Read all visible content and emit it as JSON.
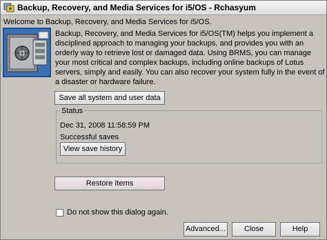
{
  "window": {
    "title": "Backup, Recovery, and Media Services for i5/OS - Rchasyum",
    "welcome": "Welcome to Backup, Recovery, and Media Services for i5/OS."
  },
  "intro": {
    "text": "Backup, Recovery, and Media Services for i5/OS(TM) helps you implement a disciplined approach to managing your backups, and provides you with an orderly way to retrieve lost or damaged data. Using BRMS, you can manage your most critical and complex backups, including online backups of Lotus servers, simply and easily. You can also recover your system fully in the event of a disaster or hardware failure."
  },
  "buttons": {
    "save_all": "Save all system and user data",
    "view_history": "View save history",
    "restore": "Restore Items",
    "advanced": "Advanced...",
    "close": "Close",
    "help": "Help"
  },
  "status": {
    "label": "Status",
    "date": "Dec 31, 2008 11:58:59 PM",
    "result": "Successful saves"
  },
  "options": {
    "dont_show": "Do not show this dialog again.",
    "dont_show_checked": false
  },
  "icons": {
    "title_icon": "backup-app-icon",
    "hero_icon": "vault-safe-icon"
  }
}
